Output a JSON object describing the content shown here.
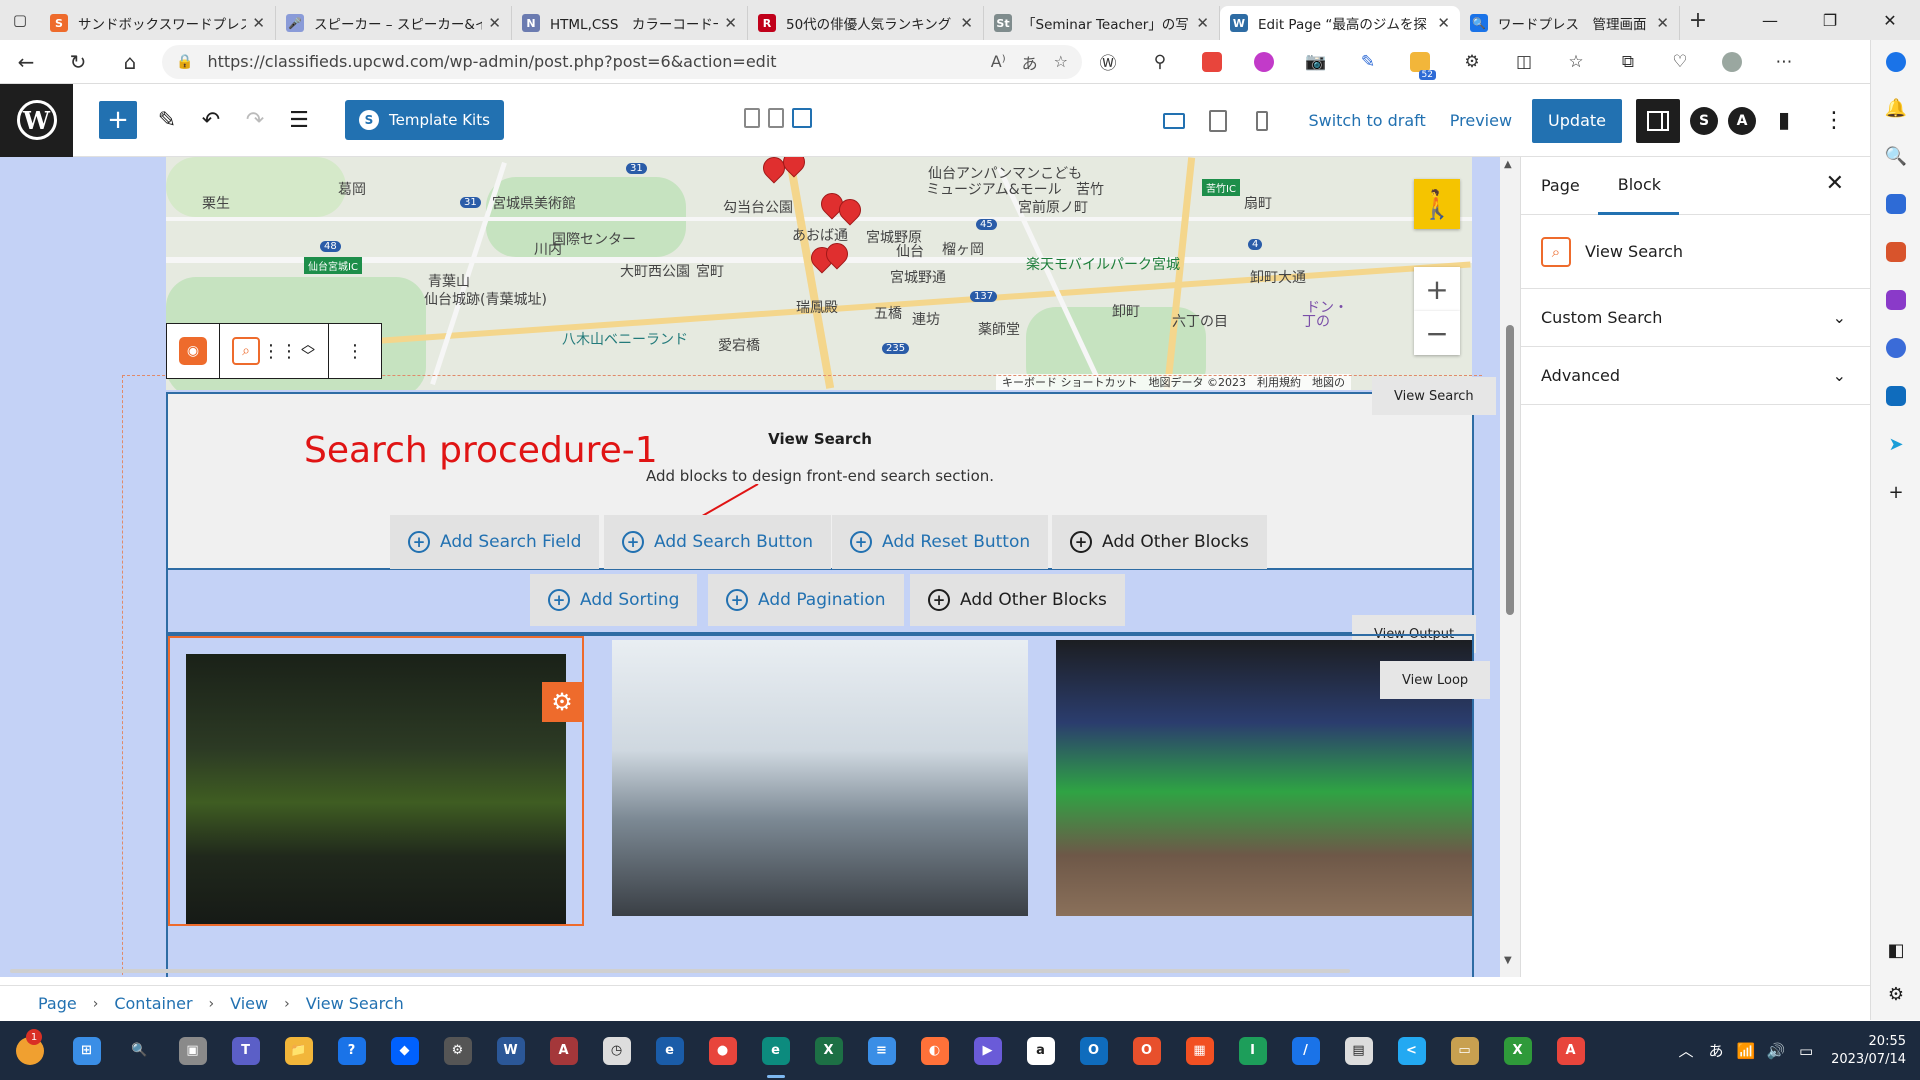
{
  "browser": {
    "tabs": [
      {
        "title": "サンドボックスワードプレスサ",
        "fav_color": "#ee6b2c",
        "fav_text": "S",
        "active": false
      },
      {
        "title": "スピーカー – スピーカー&イベ",
        "fav_color": "#8a9bd8",
        "fav_text": "🎤",
        "active": false
      },
      {
        "title": "HTML,CSS　カラーコード一",
        "fav_color": "#6b7bb0",
        "fav_text": "N",
        "active": false
      },
      {
        "title": "50代の俳優人気ランキング",
        "fav_color": "#c0001a",
        "fav_text": "R",
        "active": false
      },
      {
        "title": "「Seminar Teacher」の写",
        "fav_color": "#7f8c8d",
        "fav_text": "St",
        "active": false
      },
      {
        "title": "Edit Page “最高のジムを探",
        "fav_color": "#2e6ca4",
        "fav_text": "W",
        "active": true
      },
      {
        "title": "ワードプレス　管理画面",
        "fav_color": "#1a73e8",
        "fav_text": "🔍",
        "active": false
      }
    ],
    "url": "https://classifieds.upcwd.com/wp-admin/post.php?post=6&action=edit",
    "ext_badge": "52"
  },
  "wp_toolbar": {
    "template_kits_label": "Template Kits",
    "switch_to_draft": "Switch to draft",
    "preview": "Preview",
    "update": "Update"
  },
  "map": {
    "labels": [
      {
        "text": "葛岡",
        "cls": ""
      },
      {
        "text": "栗生",
        "cls": ""
      },
      {
        "text": "宮城県美術館",
        "cls": ""
      },
      {
        "text": "勾当台公園",
        "cls": ""
      },
      {
        "text": "仙台アンパンマンこども",
        "cls": ""
      },
      {
        "text": "ミュージアム&モール",
        "cls": ""
      },
      {
        "text": "苦竹",
        "cls": ""
      },
      {
        "text": "扇町",
        "cls": ""
      },
      {
        "text": "国際センター",
        "cls": ""
      },
      {
        "text": "川内",
        "cls": ""
      },
      {
        "text": "あおば通",
        "cls": ""
      },
      {
        "text": "仙台",
        "cls": ""
      },
      {
        "text": "宮城野通",
        "cls": ""
      },
      {
        "text": "楽天モバイルパーク宮城",
        "cls": "green"
      },
      {
        "text": "青葉山",
        "cls": ""
      },
      {
        "text": "大町西公園",
        "cls": ""
      },
      {
        "text": "仙台城跡(青葉城址)",
        "cls": ""
      },
      {
        "text": "瑞鳳殿",
        "cls": ""
      },
      {
        "text": "卸町大通",
        "cls": ""
      },
      {
        "text": "卸町",
        "cls": ""
      },
      {
        "text": "六丁の目",
        "cls": ""
      },
      {
        "text": "五橋",
        "cls": ""
      },
      {
        "text": "連坊",
        "cls": ""
      },
      {
        "text": "薬師堂",
        "cls": ""
      },
      {
        "text": "八木山ベニーランド",
        "cls": "teal"
      },
      {
        "text": "愛宕橋",
        "cls": ""
      },
      {
        "text": "宮町",
        "cls": ""
      },
      {
        "text": "榴ヶ岡",
        "cls": ""
      },
      {
        "text": "宮前原ノ町",
        "cls": ""
      },
      {
        "text": "宮城野原",
        "cls": ""
      },
      {
        "text": "ドン・",
        "cls": "purple"
      },
      {
        "text": "丁の",
        "cls": "purple"
      }
    ],
    "shields": [
      "31",
      "31",
      "48",
      "45",
      "137",
      "235",
      "4"
    ],
    "ic_labels": [
      "仙台宮城IC",
      "苦竹IC"
    ],
    "footer": "キーボード ショートカット　地図データ ©2023　利用規約　地図の"
  },
  "block_toolbar": {
    "parent_icon": "view-icon",
    "search_icon": "search-icon"
  },
  "view_search": {
    "tag": "View Search",
    "title": "View Search",
    "description": "Add blocks to design front-end search section.",
    "annotation": "Search procedure-1",
    "buttons": {
      "add_search_field": "Add Search Field",
      "add_search_button": "Add Search Button",
      "add_reset_button": "Add Reset Button",
      "add_other_blocks": "Add Other Blocks"
    }
  },
  "view_output": {
    "tag": "View Output",
    "buttons": {
      "add_sorting": "Add Sorting",
      "add_pagination": "Add Pagination",
      "add_other_blocks": "Add Other Blocks"
    }
  },
  "view_loop": {
    "tag": "View Loop"
  },
  "inspector": {
    "tab_page": "Page",
    "tab_block": "Block",
    "block_name": "View Search",
    "panels": [
      "Custom Search",
      "Advanced"
    ]
  },
  "breadcrumb": [
    "Page",
    "Container",
    "View",
    "View Search"
  ],
  "taskbar": {
    "notif_count": "1",
    "time": "20:55",
    "date": "2023/07/14",
    "ime": "あ",
    "apps": [
      {
        "name": "start",
        "color": "#3a8ee6",
        "label": "⊞"
      },
      {
        "name": "search",
        "color": "transparent",
        "label": "🔍"
      },
      {
        "name": "task-view",
        "color": "#8a8a8a",
        "label": "▣"
      },
      {
        "name": "teams",
        "color": "#5b5fc7",
        "label": "T"
      },
      {
        "name": "explorer",
        "color": "#f2b63a",
        "label": "📁"
      },
      {
        "name": "help",
        "color": "#1a73e8",
        "label": "?"
      },
      {
        "name": "dropbox",
        "color": "#0061fe",
        "label": "◆"
      },
      {
        "name": "app-gear",
        "color": "#555",
        "label": "⚙"
      },
      {
        "name": "word",
        "color": "#2b5797",
        "label": "W"
      },
      {
        "name": "access",
        "color": "#a4373a",
        "label": "A"
      },
      {
        "name": "clock",
        "color": "#ddd",
        "label": "◷"
      },
      {
        "name": "ie-pwa",
        "color": "#1a5ca8",
        "label": "e"
      },
      {
        "name": "chrome",
        "color": "#e8453c",
        "label": "●"
      },
      {
        "name": "edge",
        "color": "#0c8b7e",
        "label": "e"
      },
      {
        "name": "excel",
        "color": "#1d7045",
        "label": "X"
      },
      {
        "name": "notepad",
        "color": "#3a8ee6",
        "label": "≡"
      },
      {
        "name": "firefox",
        "color": "#ff7139",
        "label": "◐"
      },
      {
        "name": "media",
        "color": "#6a5bd8",
        "label": "▶"
      },
      {
        "name": "amazon",
        "color": "#fff",
        "label": "a"
      },
      {
        "name": "outlook",
        "color": "#0f6cbd",
        "label": "O"
      },
      {
        "name": "office",
        "color": "#e8502c",
        "label": "O"
      },
      {
        "name": "store",
        "color": "#f25022",
        "label": "▦"
      },
      {
        "name": "sheets",
        "color": "#1d9e5a",
        "label": "I"
      },
      {
        "name": "pen",
        "color": "#1a73e8",
        "label": "/"
      },
      {
        "name": "docs",
        "color": "#ddd",
        "label": "▤"
      },
      {
        "name": "vscode",
        "color": "#23a9f2",
        "label": "<"
      },
      {
        "name": "archive",
        "color": "#c8a050",
        "label": "▭"
      },
      {
        "name": "xbox",
        "color": "#2f9a3a",
        "label": "X"
      },
      {
        "name": "acrobat",
        "color": "#e8453c",
        "label": "A"
      }
    ]
  }
}
